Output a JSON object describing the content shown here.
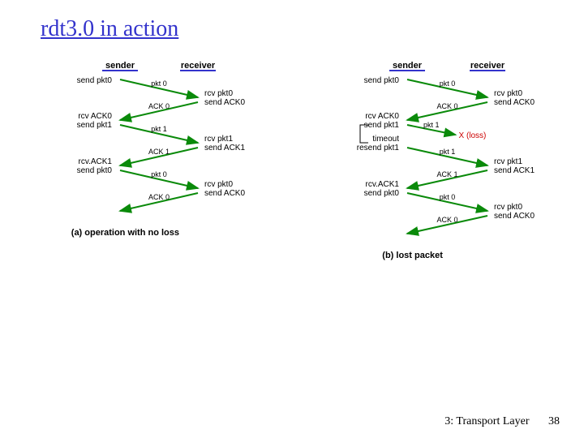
{
  "title": "rdt3.0 in action",
  "footer": {
    "text": "3: Transport Layer",
    "page": "38"
  },
  "col": {
    "sender": "sender",
    "receiver": "receiver"
  },
  "left": {
    "caption": "(a) operation with no loss",
    "events": [
      {
        "t": "send",
        "side": "L",
        "txt": "send pkt0"
      },
      {
        "t": "msg",
        "dir": "r",
        "lbl": "pkt 0"
      },
      {
        "t": "recv",
        "side": "R",
        "l1": "rcv pkt0",
        "l2": "send ACK0"
      },
      {
        "t": "msg",
        "dir": "l",
        "lbl": "ACK 0"
      },
      {
        "t": "recv",
        "side": "L",
        "l1": "rcv ACK0",
        "l2": "send pkt1"
      },
      {
        "t": "msg",
        "dir": "r",
        "lbl": "pkt 1"
      },
      {
        "t": "recv",
        "side": "R",
        "l1": "rcv pkt1",
        "l2": "send ACK1"
      },
      {
        "t": "msg",
        "dir": "l",
        "lbl": "ACK 1"
      },
      {
        "t": "recv",
        "side": "L",
        "l1": "rcv.ACK1",
        "l2": "send pkt0"
      },
      {
        "t": "msg",
        "dir": "r",
        "lbl": "pkt 0"
      },
      {
        "t": "recv",
        "side": "R",
        "l1": "rcv pkt0",
        "l2": "send ACK0"
      },
      {
        "t": "msg",
        "dir": "l",
        "lbl": "ACK 0"
      }
    ]
  },
  "right": {
    "caption": "(b) lost packet",
    "events": [
      {
        "t": "send",
        "side": "L",
        "txt": "send pkt0"
      },
      {
        "t": "msg",
        "dir": "r",
        "lbl": "pkt 0"
      },
      {
        "t": "recv",
        "side": "R",
        "l1": "rcv pkt0",
        "l2": "send ACK0"
      },
      {
        "t": "msg",
        "dir": "l",
        "lbl": "ACK 0"
      },
      {
        "t": "recv",
        "side": "L",
        "l1": "rcv ACK0",
        "l2": "send pkt1"
      },
      {
        "t": "msg",
        "dir": "r",
        "lbl": "pkt 1",
        "lost": true,
        "lossLabel": "X (loss)"
      },
      {
        "t": "recv",
        "side": "L",
        "l1": "timeout",
        "l2": "resend pkt1",
        "bracket": true
      },
      {
        "t": "msg",
        "dir": "r",
        "lbl": "pkt 1"
      },
      {
        "t": "recv",
        "side": "R",
        "l1": "rcv pkt1",
        "l2": "send ACK1"
      },
      {
        "t": "msg",
        "dir": "l",
        "lbl": "ACK 1"
      },
      {
        "t": "recv",
        "side": "L",
        "l1": "rcv.ACK1",
        "l2": "send pkt0"
      },
      {
        "t": "msg",
        "dir": "r",
        "lbl": "pkt 0"
      },
      {
        "t": "recv",
        "side": "R",
        "l1": "rcv pkt0",
        "l2": "send ACK0"
      },
      {
        "t": "msg",
        "dir": "l",
        "lbl": "ACK 0"
      }
    ]
  }
}
